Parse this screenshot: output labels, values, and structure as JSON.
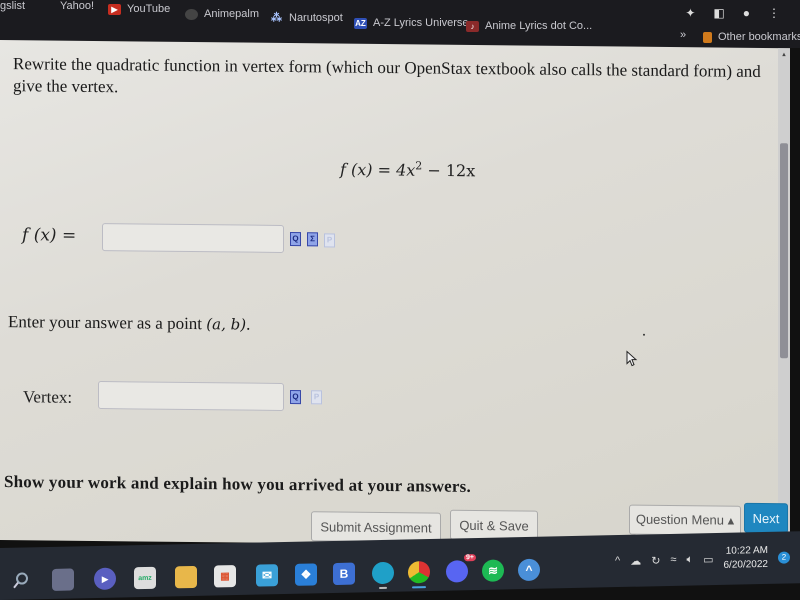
{
  "bookmarks_bar": {
    "items": [
      {
        "label": "gslist",
        "icon": "bookmark-icon"
      },
      {
        "label": "Yahoo!",
        "icon": "yahoo-icon"
      },
      {
        "label": "YouTube",
        "icon": "youtube-icon"
      },
      {
        "label": "Animepalm",
        "icon": "globe-icon"
      },
      {
        "label": "Narutospot",
        "icon": "narutospot-icon"
      },
      {
        "label": "A-Z Lyrics Universe",
        "icon": "azlyrics-icon"
      },
      {
        "label": "Anime Lyrics dot Co...",
        "icon": "animelyrics-icon"
      }
    ],
    "overflow_label": "»",
    "other_bookmarks_label": "Other bookmarks"
  },
  "question": {
    "prompt": "Rewrite the quadratic function in vertex form (which our OpenStax textbook also calls the standard form) and give the vertex.",
    "function_lhs": "f (x) = ",
    "function_rhs_a": "4x",
    "function_exp": "2",
    "function_rhs_b": " − 12x",
    "fx_label": "f (x) =",
    "fx_value": "",
    "instruction_prefix": "Enter your answer as a point ",
    "instruction_point": "(a, b)",
    "instruction_suffix": ".",
    "vertex_label": "Vertex:",
    "vertex_value": "",
    "show_work": "Show your work and explain how you arrived at your answers."
  },
  "tools": {
    "preview_glyph": "Q",
    "equation_glyph": "Σ",
    "pdf_glyph": "P"
  },
  "buttons": {
    "submit": "Submit Assignment",
    "quit": "Quit & Save",
    "question_menu": "Question Menu ▴",
    "next": "Next"
  },
  "taskbar": {
    "apps": [
      {
        "name": "search"
      },
      {
        "name": "task-view"
      },
      {
        "name": "meet"
      },
      {
        "name": "amazon"
      },
      {
        "name": "file-explorer"
      },
      {
        "name": "store"
      },
      {
        "name": "mail"
      },
      {
        "name": "dropbox"
      },
      {
        "name": "b-app"
      },
      {
        "name": "edge"
      },
      {
        "name": "chrome"
      },
      {
        "name": "discord"
      },
      {
        "name": "spotify"
      },
      {
        "name": "nordvpn"
      }
    ],
    "discord_badge": "9+",
    "time": "10:22 AM",
    "date": "6/20/2022",
    "notifications": "2"
  },
  "colors": {
    "next_button": "#1f87c0",
    "taskbar": "#252a33"
  }
}
